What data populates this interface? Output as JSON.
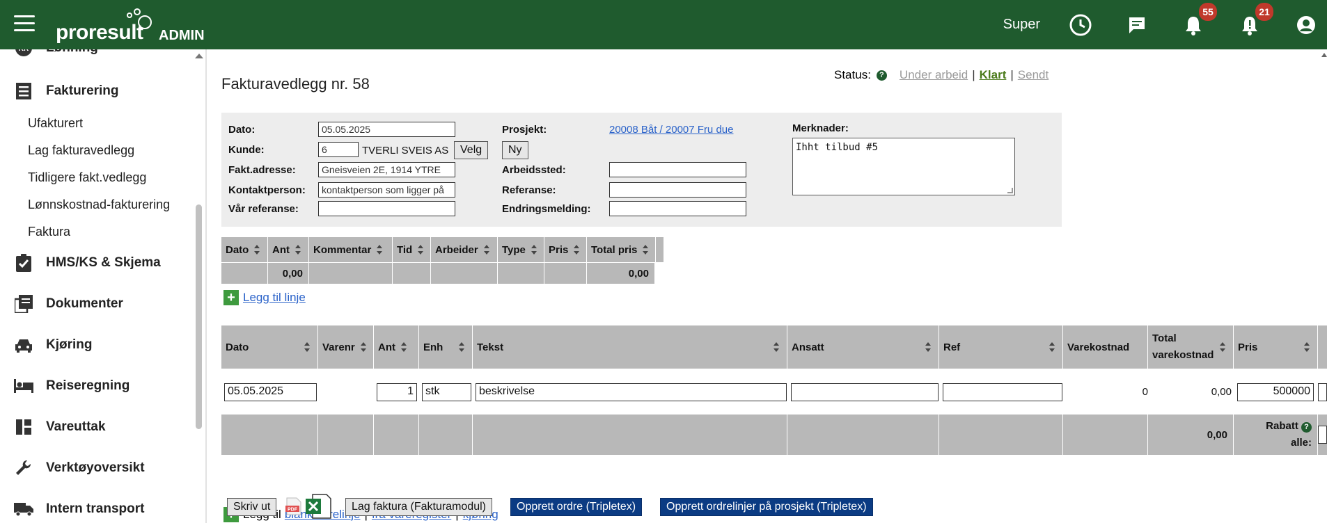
{
  "topbar": {
    "logo_text": "proresult",
    "logo_admin": "ADMIN",
    "user": "Super",
    "notifications_count": "55",
    "alerts_count": "21"
  },
  "sidebar": {
    "partial_item": {
      "icon": "kr-icon",
      "label": "Lønning"
    },
    "fakturering": {
      "label": "Fakturering"
    },
    "sub_items": [
      "Ufakturert",
      "Lag fakturavedlegg",
      "Tidligere fakt.vedlegg",
      "Lønnskostnad-fakturering",
      "Faktura"
    ],
    "items": [
      {
        "label": "HMS/KS & Skjema",
        "icon": "clipboard-check-icon"
      },
      {
        "label": "Dokumenter",
        "icon": "documents-icon"
      },
      {
        "label": "Kjøring",
        "icon": "car-icon"
      },
      {
        "label": "Reiseregning",
        "icon": "bed-icon"
      },
      {
        "label": "Vareuttak",
        "icon": "dashboard-icon"
      },
      {
        "label": "Verktøyoversikt",
        "icon": "wrench-icon"
      },
      {
        "label": "Intern transport",
        "icon": "truck-icon"
      }
    ]
  },
  "page": {
    "title": "Fakturavedlegg nr. 58",
    "status_label": "Status:",
    "status_options": [
      "Under arbeid",
      "Klart",
      "Sendt"
    ]
  },
  "form": {
    "dato_label": "Dato:",
    "dato_value": "05.05.2025",
    "kunde_label": "Kunde:",
    "kunde_nr": "6",
    "kunde_name": "TVERLI SVEIS AS",
    "velg_label": "Velg",
    "fakt_label": "Fakt.adresse:",
    "fakt_value": "Gneisveien 2E, 1914 YTRE",
    "kontakt_label": "Kontaktperson:",
    "kontakt_value": "kontaktperson som ligger på",
    "var_ref_label": "Vår referanse:",
    "var_ref_value": "",
    "prosjekt_label": "Prosjekt:",
    "prosjekt_link": "20008 Båt / 20007 Fru due",
    "ny_label": "Ny",
    "arbeidssted_label": "Arbeidssted:",
    "referanse_label": "Referanse:",
    "endring_label": "Endringsmelding:",
    "merknader_label": "Merknader:",
    "merknader_value": "Ihht tilbud #5"
  },
  "time_table": {
    "headers": [
      "Dato",
      "Ant",
      "Kommentar",
      "Tid",
      "Arbeider",
      "Type",
      "Pris",
      "Total pris"
    ],
    "footer_ant": "0,00",
    "footer_total": "0,00",
    "add_label": "Legg til linje"
  },
  "goods_table": {
    "headers": [
      "Dato",
      "Varenr",
      "Ant",
      "Enh",
      "Tekst",
      "Ansatt",
      "Ref",
      "Varekostnad",
      "Total varekostnad",
      "Pris"
    ],
    "row": {
      "dato": "05.05.2025",
      "varenr": "",
      "ant": "1",
      "enh": "stk",
      "tekst": "beskrivelse",
      "ansatt": "",
      "ref": "",
      "varekostnad": "0",
      "total_varekostnad": "0,00",
      "pris": "500000"
    },
    "footer_total": "0,00",
    "rabatt_label": "Rabatt",
    "alle_label": "alle:",
    "add_prefix": "Legg til",
    "add_blank": "blank varelinje",
    "add_register": "fra vareregister",
    "add_kjoring": "kjøring"
  },
  "actions": {
    "skriv_ut": "Skriv ut",
    "lag_faktura": "Lag faktura (Fakturamodul)",
    "opprett_ordre": "Opprett ordre (Tripletex)",
    "opprett_ordrelinjer": "Opprett ordrelinjer på prosjekt (Tripletex)"
  }
}
